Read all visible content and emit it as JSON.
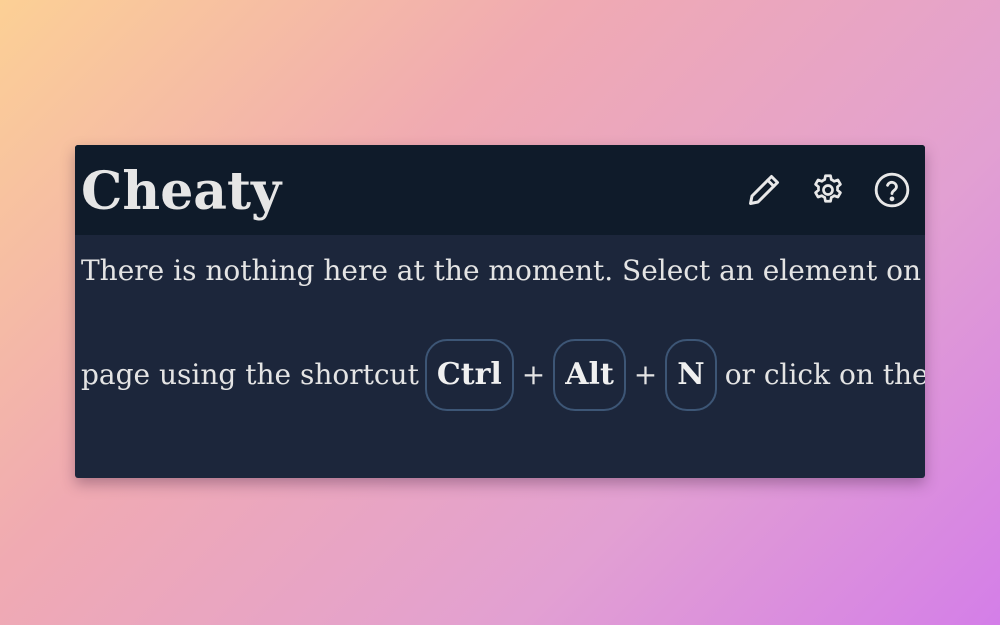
{
  "app": {
    "title": "Cheaty"
  },
  "header": {
    "icons": [
      "pencil-icon",
      "gear-icon",
      "help-icon"
    ]
  },
  "empty_state": {
    "line1": "There is nothing here at the moment. Select an element on the",
    "line2_prefix": "page using the shortcut",
    "keys": [
      "Ctrl",
      "Alt",
      "N"
    ],
    "plus": "+",
    "line2_suffix": "or click on the",
    "trailing_icon": "pencil-icon"
  },
  "colors": {
    "panel_bg": "#1c263b",
    "header_bg": "#0f1b2a",
    "text": "#e4e4e4",
    "key_border": "#3d5676"
  }
}
